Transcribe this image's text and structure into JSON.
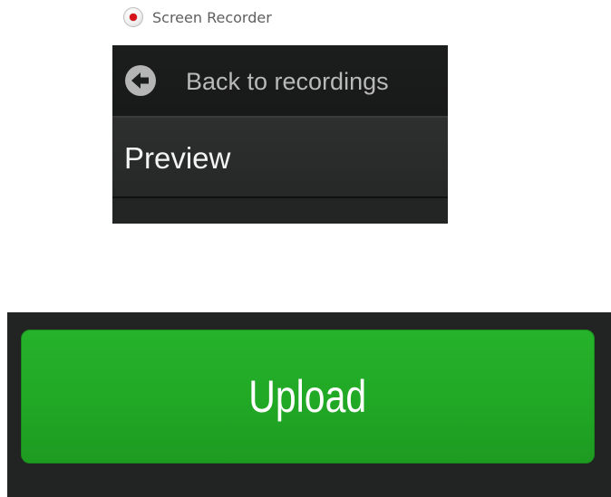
{
  "window": {
    "title": "Screen Recorder",
    "icon": "record-icon"
  },
  "nav": {
    "back_label": "Back to recordings",
    "back_icon": "back-arrow-circle-icon"
  },
  "section": {
    "title": "Preview"
  },
  "actions": {
    "upload_label": "Upload"
  },
  "colors": {
    "panel_dark": "#1b1c1c",
    "preview_bar": "#2e2f2f",
    "upload_green": "#21a825",
    "record_red": "#d7141a"
  }
}
